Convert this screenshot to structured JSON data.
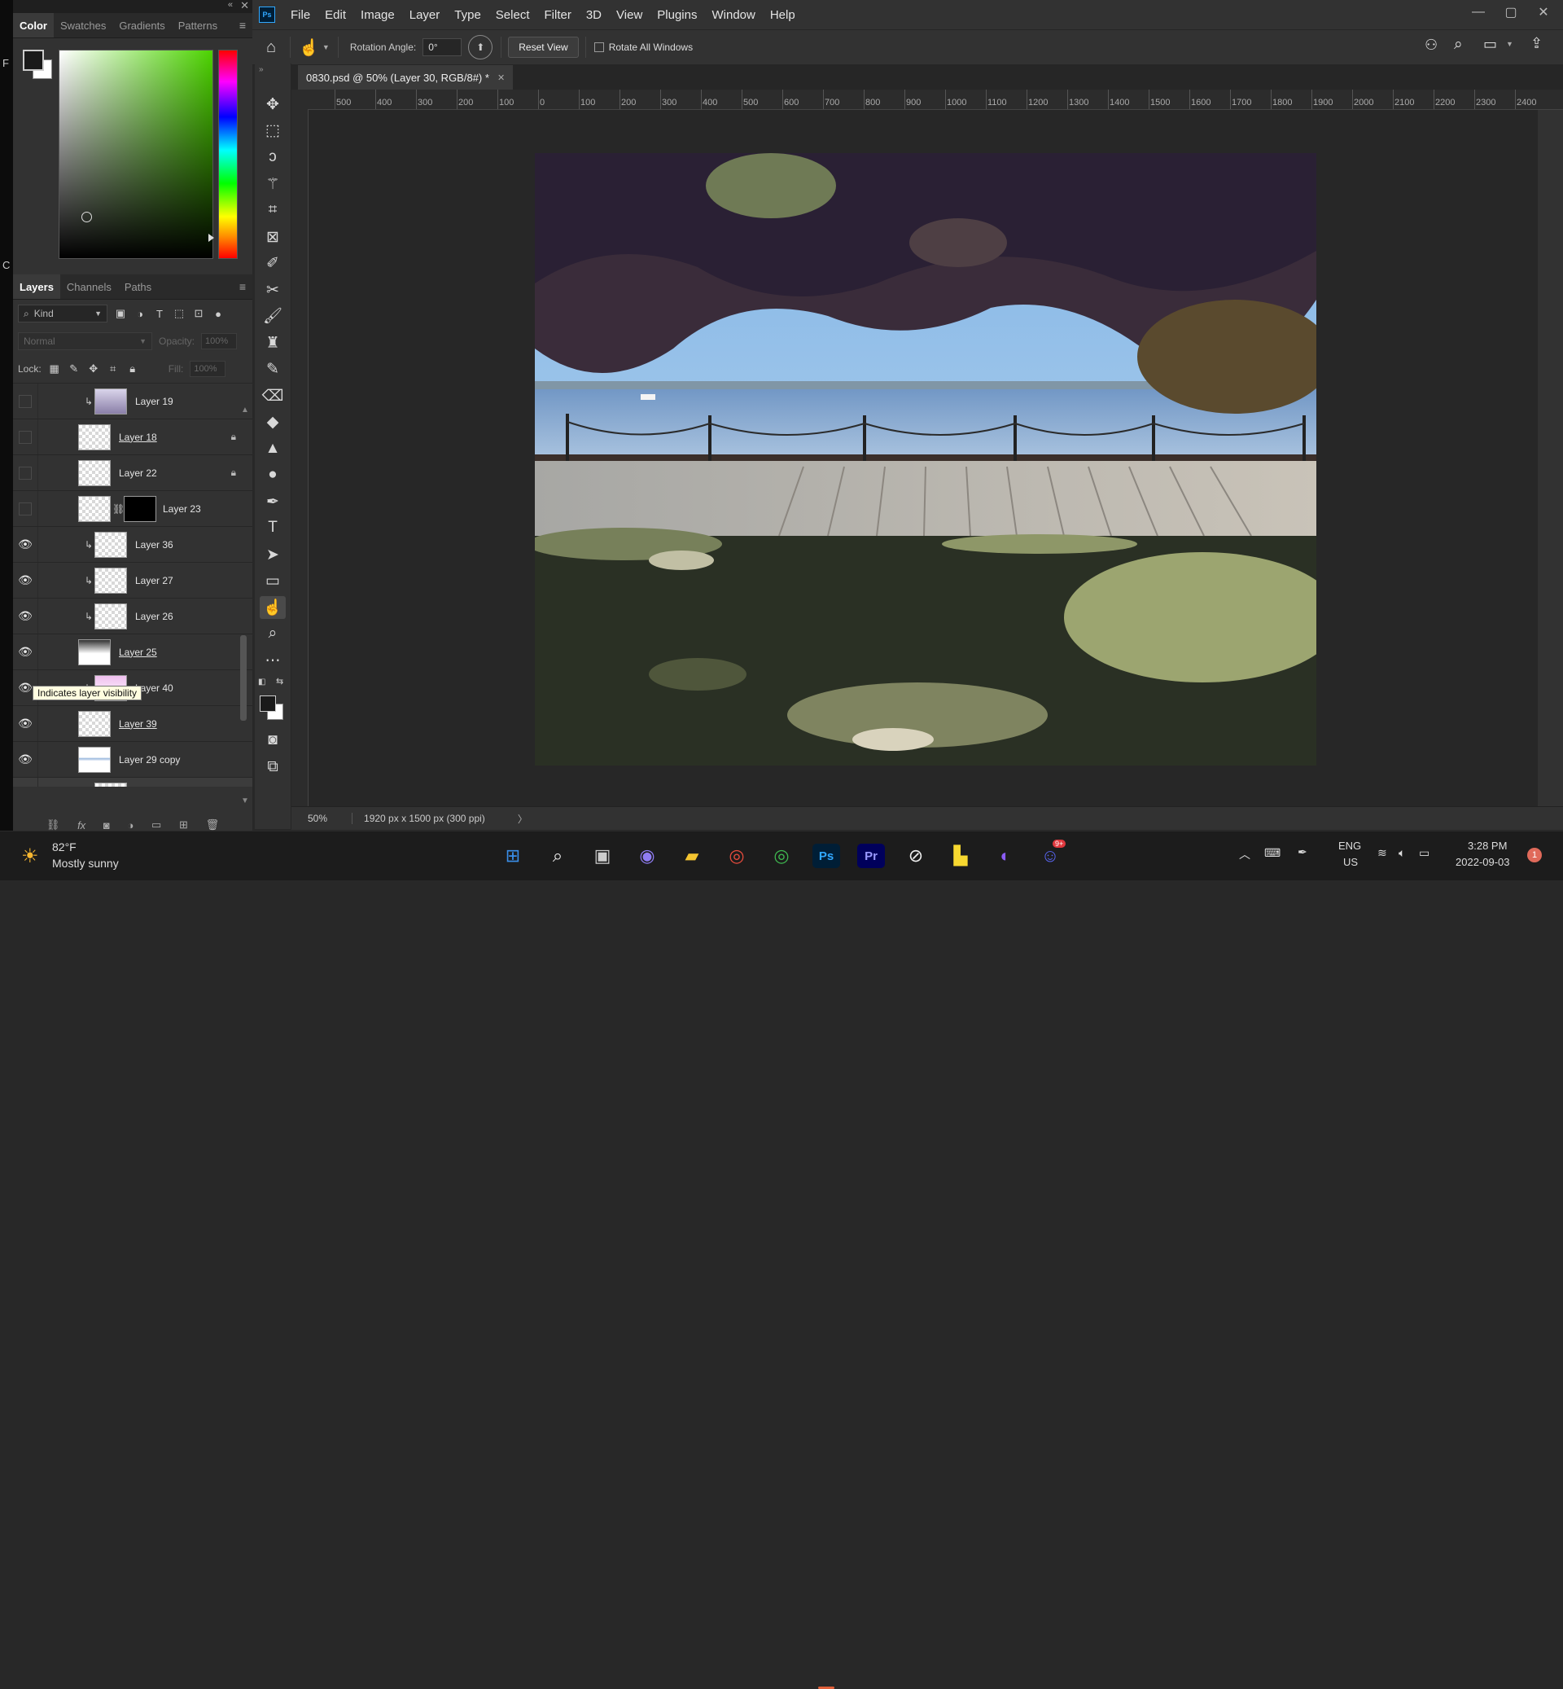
{
  "left_panel": {
    "collapse_icon": "double-chevron-left-icon",
    "close_icon": "close-icon",
    "color_tabs": [
      "Color",
      "Swatches",
      "Gradients",
      "Patterns"
    ],
    "foreground_color": "#1a1a1a",
    "background_color": "#ffffff",
    "hue_color": "#4cd300"
  },
  "layers_panel": {
    "tabs": [
      "Layers",
      "Channels",
      "Paths"
    ],
    "filter_kind": "Kind",
    "blend_mode": "Normal",
    "opacity_label": "Opacity:",
    "opacity_value": "100%",
    "lock_label": "Lock:",
    "fill_label": "Fill:",
    "fill_value": "100%",
    "tooltip": "Indicates layer visibility",
    "layers": [
      {
        "name": "Layer 19",
        "visible": false,
        "clipped": true,
        "locked": false
      },
      {
        "name": "Layer 18",
        "visible": false,
        "clipped": false,
        "locked": true
      },
      {
        "name": "Layer 22",
        "visible": false,
        "clipped": false,
        "locked": true
      },
      {
        "name": "Layer 23",
        "visible": false,
        "clipped": false,
        "locked": false,
        "mask": true
      },
      {
        "name": "Layer 36",
        "visible": true,
        "clipped": true,
        "locked": false
      },
      {
        "name": "Layer 27",
        "visible": true,
        "clipped": true,
        "locked": false
      },
      {
        "name": "Layer 26",
        "visible": true,
        "clipped": true,
        "locked": false
      },
      {
        "name": "Layer 25",
        "visible": true,
        "clipped": false,
        "locked": false
      },
      {
        "name": "Layer 40",
        "visible": true,
        "clipped": true,
        "locked": false
      },
      {
        "name": "Layer 39",
        "visible": true,
        "clipped": false,
        "locked": false
      },
      {
        "name": "Layer 29 copy",
        "visible": true,
        "clipped": false,
        "locked": false
      }
    ]
  },
  "menubar": {
    "items": [
      "File",
      "Edit",
      "Image",
      "Layer",
      "Type",
      "Select",
      "Filter",
      "3D",
      "View",
      "Plugins",
      "Window",
      "Help"
    ],
    "app_logo": "Ps"
  },
  "options_bar": {
    "rotation_label": "Rotation Angle:",
    "rotation_value": "0°",
    "reset_view": "Reset View",
    "rotate_all_windows": "Rotate All Windows"
  },
  "document": {
    "tab_title": "0830.psd @ 50% (Layer 30, RGB/8#) *",
    "zoom": "50%",
    "doc_info": "1920 px x 1500 px (300 ppi)",
    "ruler_top": [
      "500",
      "400",
      "300",
      "200",
      "100",
      "0",
      "100",
      "200",
      "300",
      "400",
      "500",
      "600",
      "700",
      "800",
      "900",
      "1000",
      "1100",
      "1200",
      "1300",
      "1400",
      "1500",
      "1600",
      "1700",
      "1800",
      "1900",
      "2000",
      "2100",
      "2200",
      "2300",
      "2400"
    ]
  },
  "taskbar": {
    "weather_temp": "82°F",
    "weather_desc": "Mostly sunny",
    "lang_top": "ENG",
    "lang_bottom": "US",
    "time": "3:28 PM",
    "date": "2022-09-03",
    "notification_count": "1",
    "discord_badge": "9+"
  }
}
